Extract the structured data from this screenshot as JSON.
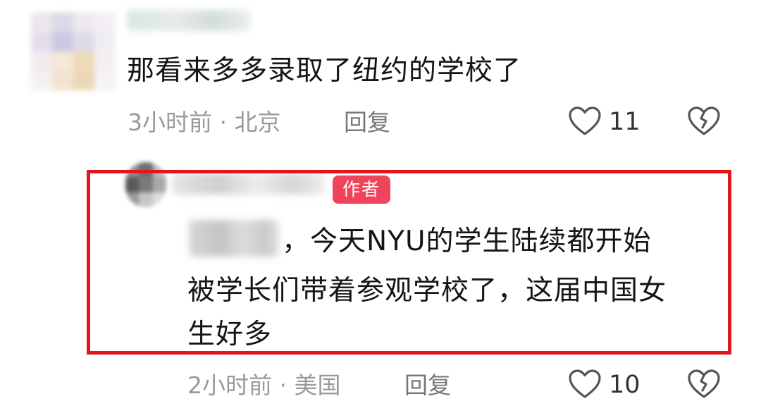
{
  "comment1": {
    "text": "那看来多多录取了纽约的学校了",
    "time_location": "3小时前 · 北京",
    "reply_label": "回复",
    "like_count": "11"
  },
  "comment2": {
    "author_badge": "作者",
    "text_line1": "，今天NYU的学生陆续都开始",
    "text_line2": "被学长们带着参观学校了，这届中国女",
    "text_line3": "生好多",
    "time_location": "2小时前 · 美国",
    "reply_label": "回复",
    "like_count": "10"
  },
  "colors": {
    "highlight_border": "#e3161d",
    "author_badge_bg": "#f0445c"
  },
  "icons": [
    "heart-outline-icon",
    "broken-heart-icon"
  ]
}
